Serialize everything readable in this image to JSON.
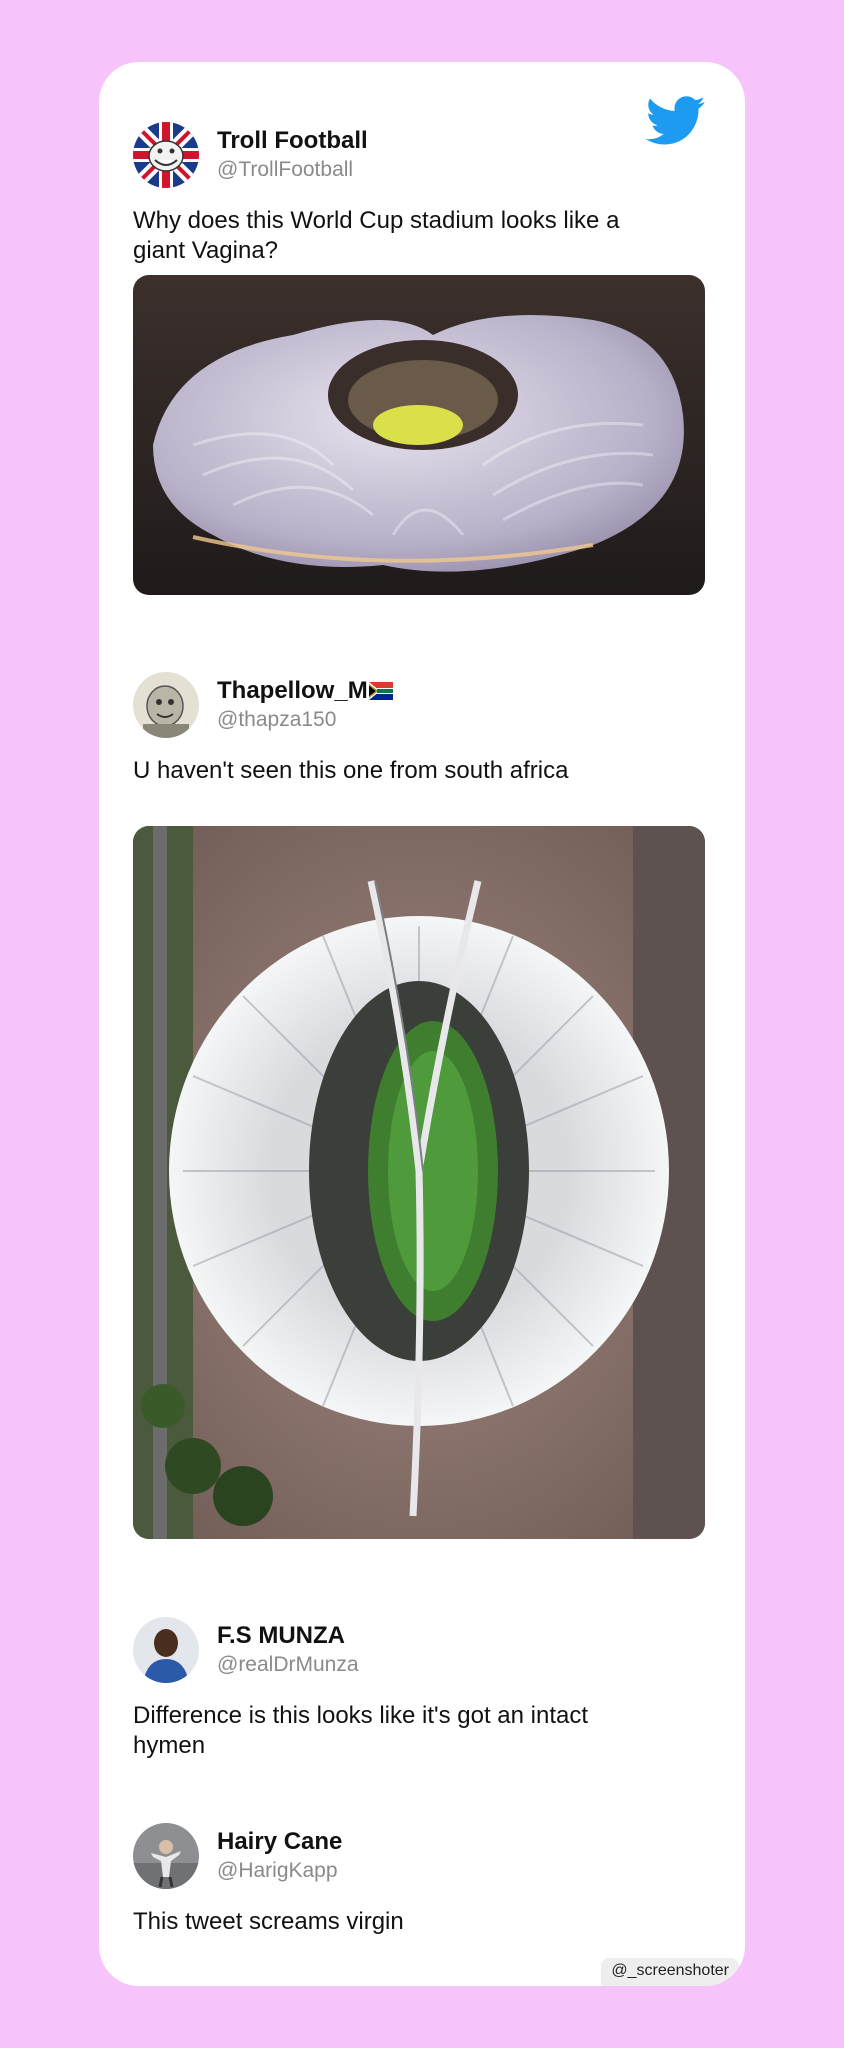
{
  "brand": {
    "logo_icon": "twitter-bird-icon",
    "accent": "#1d9bf0",
    "background": "#f6c4fb"
  },
  "tweets": [
    {
      "display_name": "Troll Football",
      "handle": "@TrollFootball",
      "text": "Why does this World Cup stadium looks like a giant Vagina?",
      "avatar_icon": "troll-face-union-jack-avatar",
      "media": "stadium-render-image"
    },
    {
      "display_name": "Thapellow_M",
      "name_emoji": "south-africa-flag-icon",
      "handle": "@thapza150",
      "text": "U haven't seen this one from south africa",
      "avatar_icon": "cartoon-avatar",
      "media": "stadium-aerial-photo"
    },
    {
      "display_name": "F.S MUNZA",
      "handle": "@realDrMunza",
      "text": "Difference is this looks like it's got an intact hymen",
      "avatar_icon": "person-photo-avatar"
    },
    {
      "display_name": "Hairy Cane",
      "handle": "@HarigKapp",
      "text": "This tweet screams virgin",
      "avatar_icon": "person-photo-avatar"
    }
  ],
  "watermark": "@_screenshoter"
}
